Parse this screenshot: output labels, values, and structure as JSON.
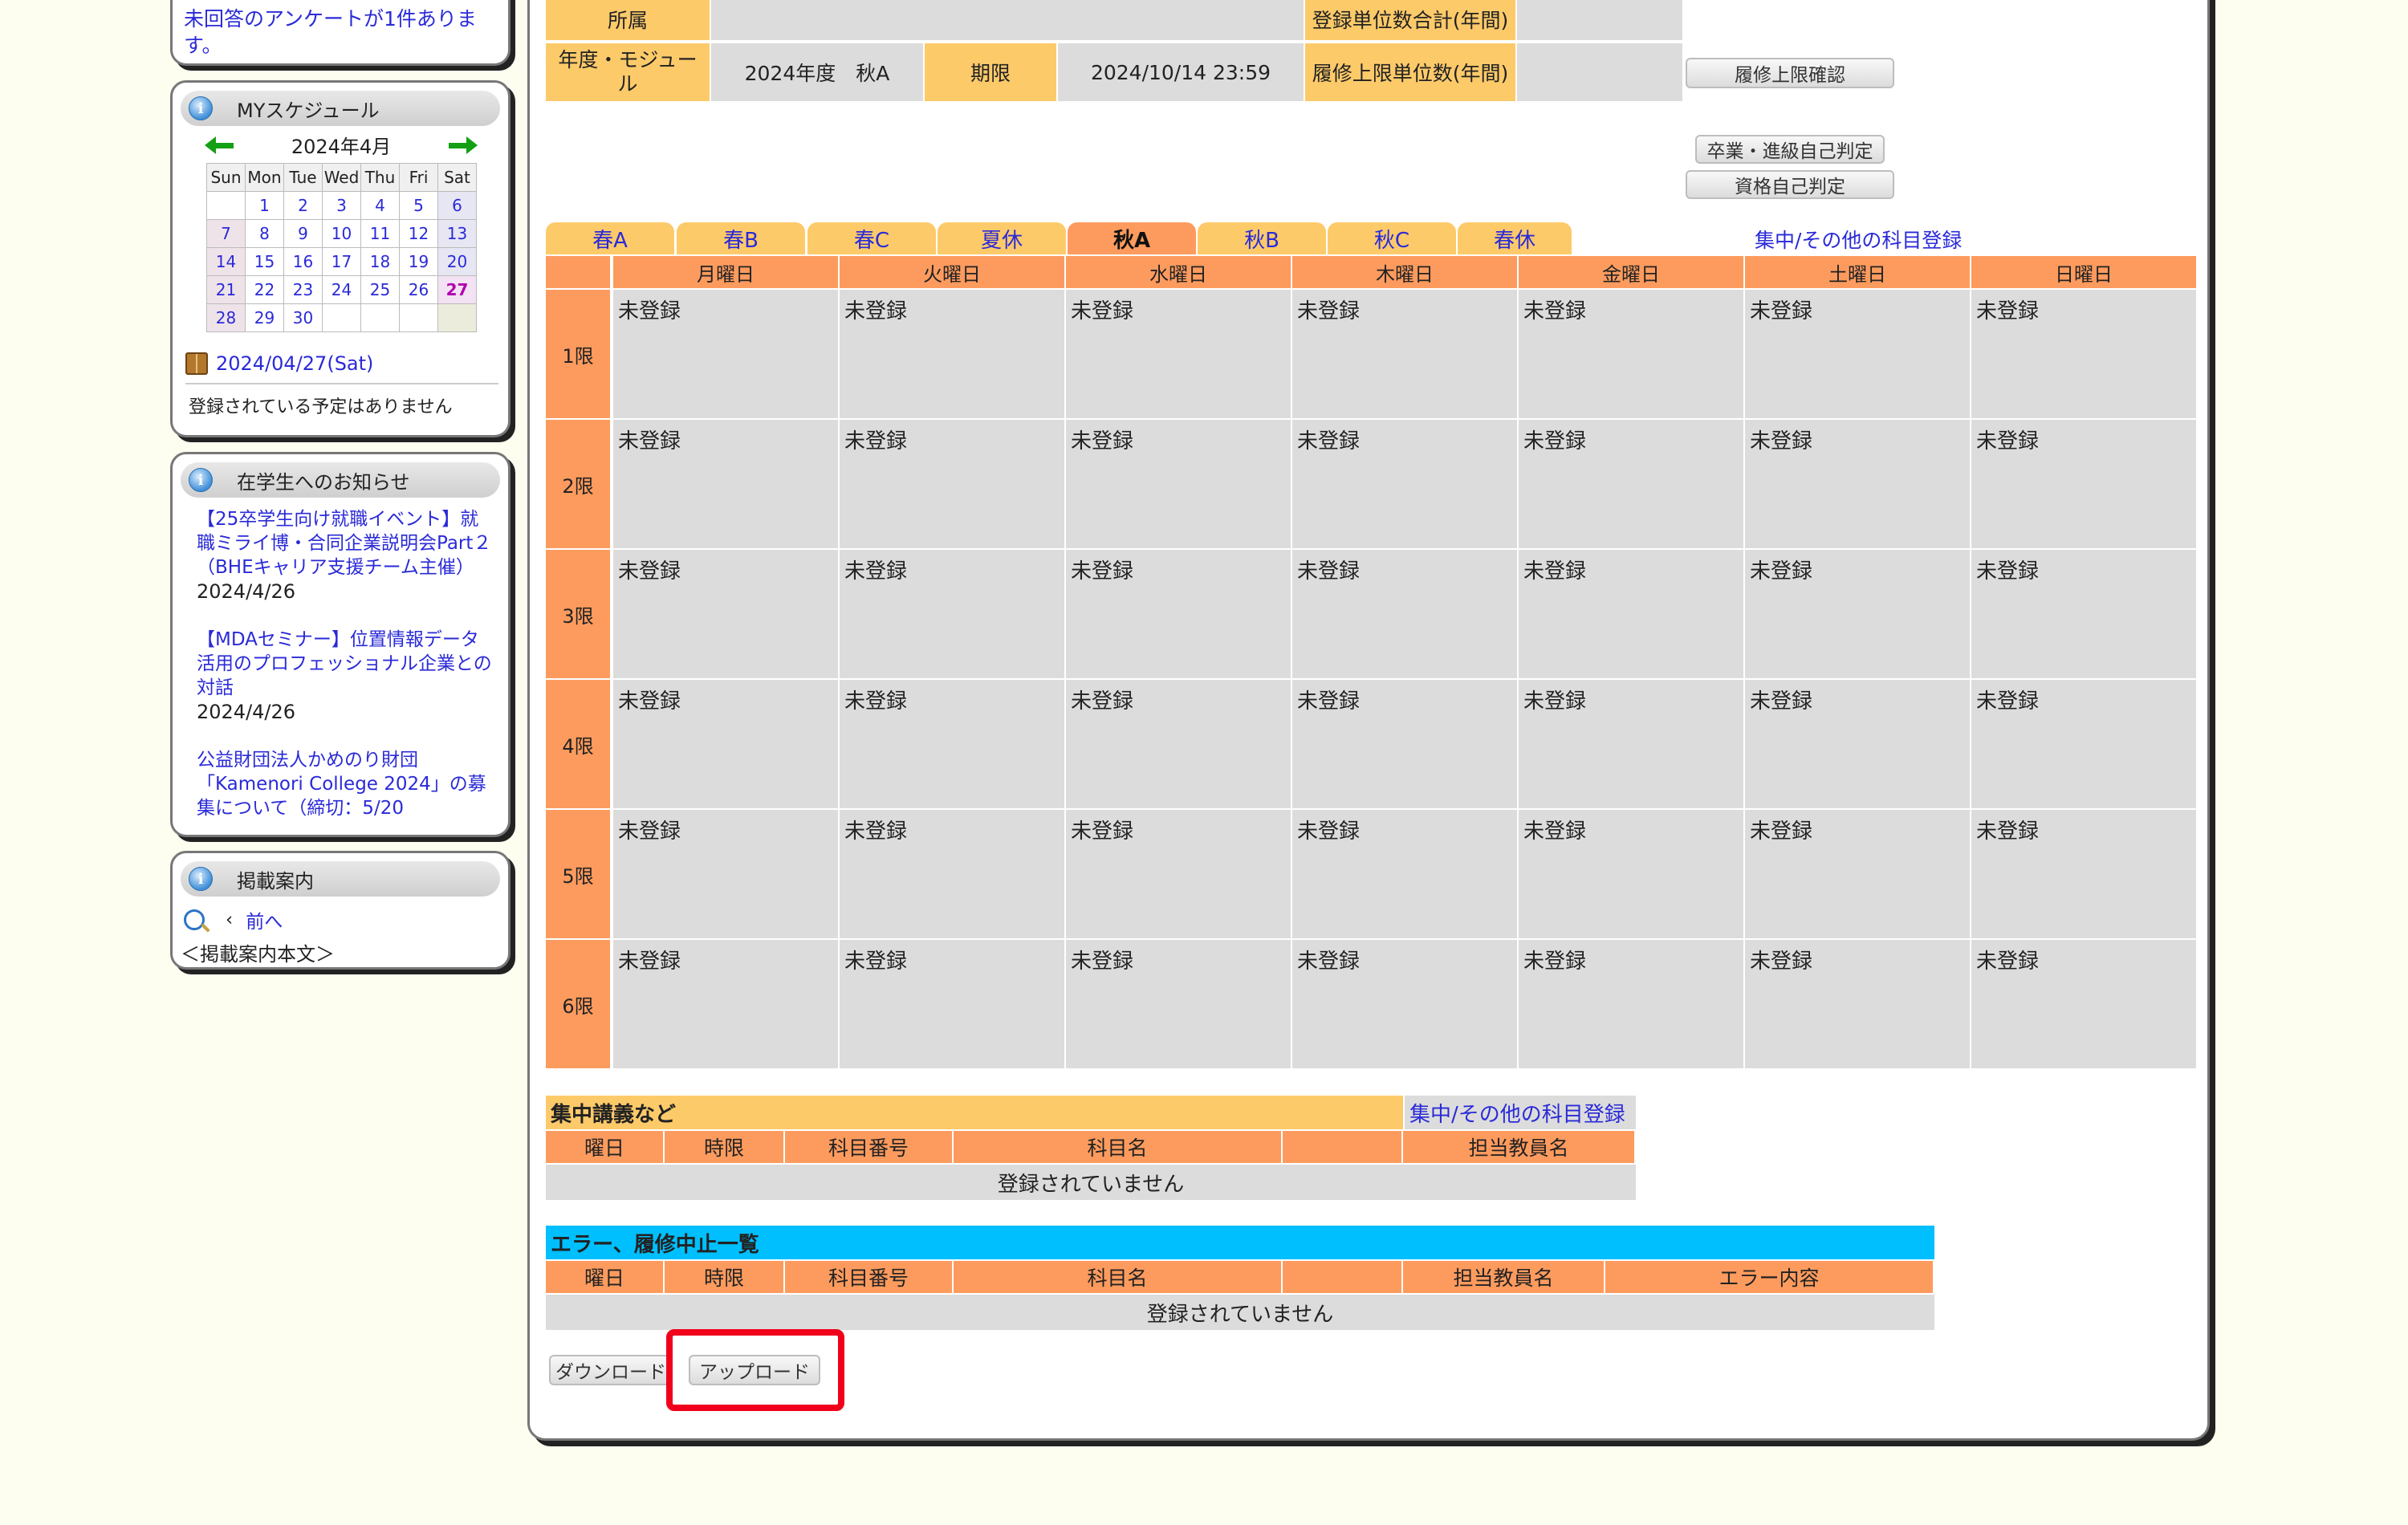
{
  "sidebar": {
    "survey_text": "未回答のアンケートが1件あります。",
    "schedule": {
      "title": "MYスケジュール",
      "month": "2024年4月",
      "weekdays": [
        "Sun",
        "Mon",
        "Tue",
        "Wed",
        "Thu",
        "Fri",
        "Sat"
      ],
      "weeks": [
        [
          "",
          "1",
          "2",
          "3",
          "4",
          "5",
          "6"
        ],
        [
          "7",
          "8",
          "9",
          "10",
          "11",
          "12",
          "13"
        ],
        [
          "14",
          "15",
          "16",
          "17",
          "18",
          "19",
          "20"
        ],
        [
          "21",
          "22",
          "23",
          "24",
          "25",
          "26",
          "27"
        ],
        [
          "28",
          "29",
          "30",
          "",
          "",
          "",
          ""
        ]
      ],
      "selected_date": "2024/04/27(Sat)",
      "no_events": "登録されている予定はありません"
    },
    "notices": {
      "title": "在学生へのお知らせ",
      "items": [
        {
          "title": "【25卒学生向け就職イベント】就職ミライ博・合同企業説明会Part２（BHEキャリア支援チーム主催）",
          "date": "2024/4/26"
        },
        {
          "title": "【MDAセミナー】位置情報データ活用のプロフェッショナル企業との対話",
          "date": "2024/4/26"
        },
        {
          "title": "公益財団法人かめのり財団「Kamenori College 2024」の募集について（締切：5/20",
          "date": ""
        }
      ]
    },
    "guide": {
      "title": "掲載案内",
      "prev_label": "前へ",
      "body": "＜掲載案内本文＞"
    }
  },
  "header": {
    "affiliation_label": "所属",
    "affiliation_value": "",
    "year_module_label": "年度・モジュール",
    "year_module_value": "2024年度　秋A",
    "deadline_label": "期限",
    "deadline_value": "2024/10/14 23:59",
    "credits_total_label": "登録単位数合計(年間)",
    "credits_total_value": "",
    "credit_limit_label": "履修上限単位数(年間)",
    "credit_limit_value": "",
    "limit_check_button": "履修上限確認",
    "graduation_button": "卒業・進級自己判定",
    "qualification_button": "資格自己判定"
  },
  "tabs": [
    "春A",
    "春B",
    "春C",
    "夏休",
    "秋A",
    "秋B",
    "秋C",
    "春休"
  ],
  "active_tab": "秋A",
  "intensive_link": "集中/その他の科目登録",
  "timetable": {
    "days": [
      "月曜日",
      "火曜日",
      "水曜日",
      "木曜日",
      "金曜日",
      "土曜日",
      "日曜日"
    ],
    "periods": [
      "1限",
      "2限",
      "3限",
      "4限",
      "5限",
      "6限"
    ],
    "cell_text": "未登録"
  },
  "intensive": {
    "title": "集中講義など",
    "link": "集中/その他の科目登録",
    "columns": [
      "曜日",
      "時限",
      "科目番号",
      "科目名",
      "",
      "担当教員名"
    ],
    "empty_text": "登録されていません"
  },
  "errors": {
    "title": "エラー、履修中止一覧",
    "columns": [
      "曜日",
      "時限",
      "科目番号",
      "科目名",
      "",
      "担当教員名",
      "エラー内容"
    ],
    "empty_text": "登録されていません"
  },
  "footer": {
    "download_button": "ダウンロード",
    "upload_button": "アップロード"
  },
  "colors": {
    "header_yellow": "#fdca6a",
    "timetable_orange": "#fd9b5e",
    "error_bar": "#00bfff",
    "cell_grey": "#dcdcdc",
    "highlight_red": "#f0001a",
    "link_blue": "#2a2ad8"
  }
}
